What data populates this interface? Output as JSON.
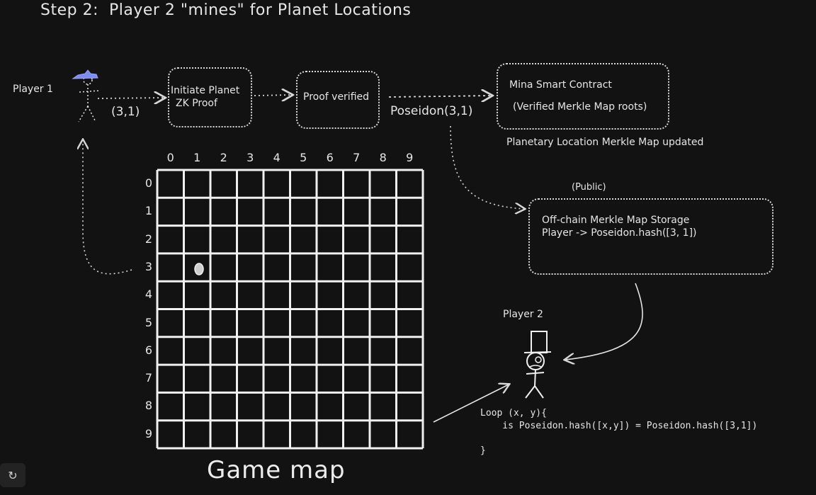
{
  "title": "Step 2:  Player 2 \"mines\" for Planet Locations",
  "player1": {
    "label": "Player 1"
  },
  "player2": {
    "label": "Player 2"
  },
  "arrow_label_coords": "(3,1)",
  "boxes": {
    "initiate": {
      "line1": "Initiate Planet",
      "line2": "ZK Proof"
    },
    "proof": {
      "text": "Proof verified"
    },
    "poseidon_label": "Poseidon(3,1)",
    "contract": {
      "line1": "Mina Smart Contract",
      "line2": "(Verified Merkle Map roots)"
    },
    "contract_caption": "Planetary Location Merkle Map updated",
    "storage_public": "(Public)",
    "storage": {
      "line1": "Off-chain Merkle Map Storage",
      "line2": "Player -> Poseidon.hash([3, 1])"
    }
  },
  "grid": {
    "columns": [
      "0",
      "1",
      "2",
      "3",
      "4",
      "5",
      "6",
      "7",
      "8",
      "9"
    ],
    "rows": [
      "0",
      "1",
      "2",
      "3",
      "4",
      "5",
      "6",
      "7",
      "8",
      "9"
    ],
    "planet_marker": {
      "row": 3,
      "col": 1
    },
    "label": "Game map"
  },
  "code": {
    "line1": "Loop (x, y){",
    "line2": "    is Poseidon.hash([x,y]) = Poseidon.hash([3,1])",
    "line3": "}"
  },
  "toolbar": {
    "undo_icon": "share-icon"
  }
}
